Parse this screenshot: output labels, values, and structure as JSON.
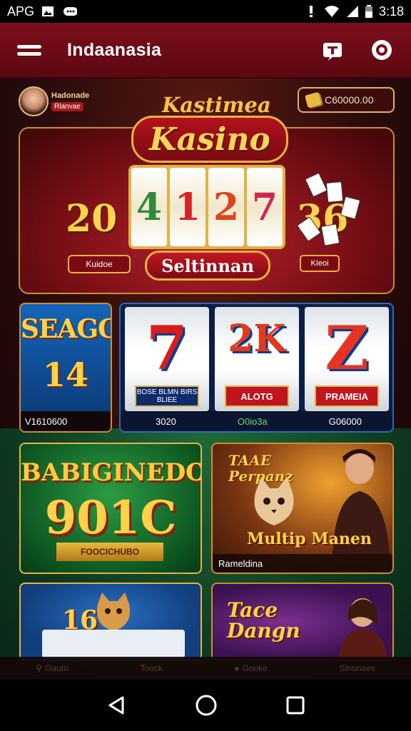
{
  "status_bar": {
    "left_text": "APG",
    "time": "3:18"
  },
  "app_bar": {
    "title": "Indaanasia"
  },
  "user": {
    "name": "Hadonade",
    "level": "Rlanvae"
  },
  "coins": {
    "amount": "C60000.00"
  },
  "hero": {
    "logo_small": "Kastimea",
    "logo_big": "Kasino",
    "number_left": "20",
    "number_right": "36",
    "reels": [
      "4",
      "1",
      "2",
      "7"
    ],
    "reel_colors": [
      "#2e8b3a",
      "#d82025",
      "#e0441c",
      "#d0274f"
    ],
    "chip_label_left": "Kuidoe",
    "chip_label_right": "KIeoi",
    "button_label": "Seltinnan"
  },
  "row2": {
    "seago": {
      "title": "SEAGO",
      "number": "14",
      "footer": "V1610600"
    },
    "slots": [
      {
        "symbol": "7",
        "color": "#d91d1d",
        "label": "BOSE BLMN BIRS BLIEE",
        "footer": "3020"
      },
      {
        "symbol": "2K",
        "color": "#e23a1b",
        "label": "ALOTG",
        "footer": "O0io3a"
      },
      {
        "symbol": "Z",
        "color": "#e63324",
        "label": "PRAMEIA",
        "footer": "G06000"
      }
    ]
  },
  "row3": {
    "green": {
      "title": "BABIGINEDO",
      "number": "901C",
      "ribbon": "FOOCICHUBO"
    },
    "pet": {
      "title_line1": "TAAE",
      "title_line2": "Perpanz",
      "subtitle": "Multip Manen",
      "footer": "Rameldina"
    }
  },
  "row4": {
    "cat": {
      "number": "16"
    },
    "dang": {
      "title_line1": "Tace",
      "title_line2": "Dangn"
    }
  },
  "tab_bar": {
    "items": [
      "Gauto",
      "Toock",
      "Gooke",
      "Sinonaes"
    ]
  }
}
